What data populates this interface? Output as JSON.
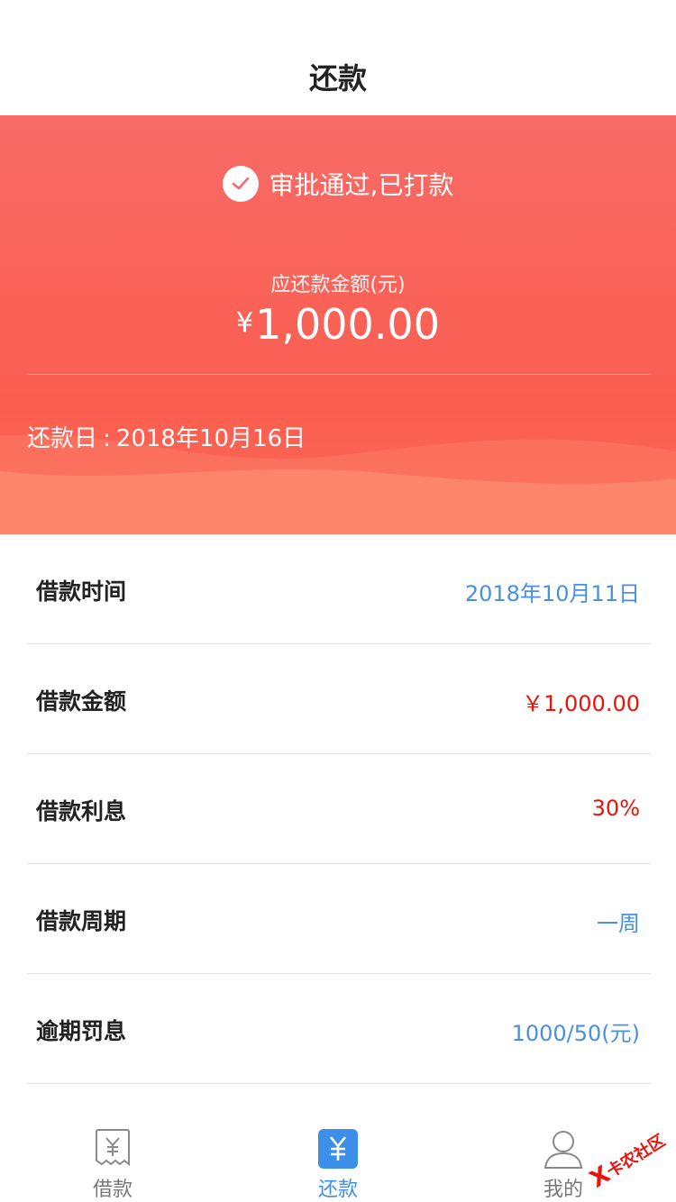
{
  "header": {
    "title": "还款"
  },
  "hero": {
    "status_text": "审批通过,已打款",
    "due_label": "应还款金额(元)",
    "due_currency": "¥",
    "due_amount": "1,000.00",
    "repay_date_label": "还款日",
    "repay_date_sep": ":",
    "repay_date_value": "2018年10月16日"
  },
  "details": [
    {
      "label": "借款时间",
      "value": "2018年10月11日",
      "color": "#4a90e2"
    },
    {
      "label": "借款金额",
      "value": "￥1,000.00",
      "color": "#e8140c"
    },
    {
      "label": "借款利息",
      "value": "30%",
      "color": "#e8140c"
    },
    {
      "label": "借款周期",
      "value": "一周",
      "color": "#4a90e2"
    },
    {
      "label": "逾期罚息",
      "value": "1000/50(元)",
      "color": "#4a90e2"
    }
  ],
  "tabs": [
    {
      "label": "借款",
      "icon": "receipt-yen-icon",
      "active": false
    },
    {
      "label": "还款",
      "icon": "yen-icon",
      "active": true
    },
    {
      "label": "我的",
      "icon": "user-icon",
      "active": false
    }
  ],
  "watermark": {
    "mark": "X",
    "text": "卡农社区"
  },
  "colors": {
    "accent_red": "#fb5e50",
    "value_blue": "#4a90e2",
    "value_red": "#e8140c",
    "tab_active": "#3b8fe8"
  }
}
